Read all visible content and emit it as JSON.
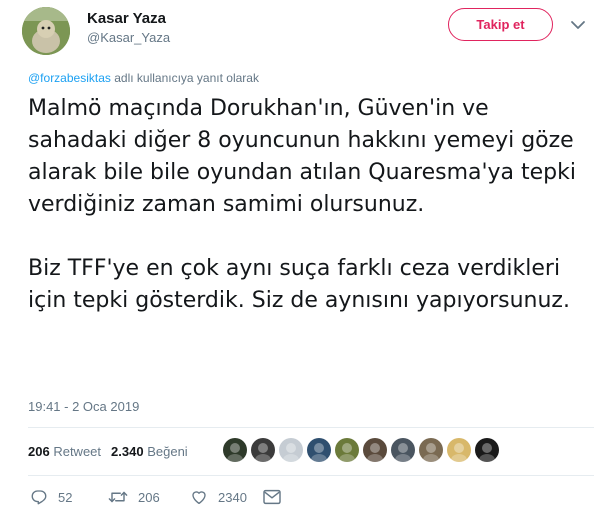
{
  "user": {
    "display_name": "Kasar Yaza",
    "handle": "@Kasar_Yaza"
  },
  "follow_button": {
    "label": "Takip et"
  },
  "reply_context": {
    "mention": "@forzabesiktas",
    "suffix": " adlı kullanıcıya yanıt olarak"
  },
  "tweet": {
    "paragraphs": [
      "Malmö maçında Dorukhan'ın, Güven'in ve sahadaki diğer 8 oyuncunun hakkını yemeyi göze alarak bile bile oyundan atılan Quaresma'ya tepki verdiğiniz zaman samimi olursunuz.",
      "Biz TFF'ye en çok aynı suça farklı ceza verdikleri için tepki gösterdik. Siz de aynısını yapıyorsunuz."
    ],
    "timestamp": "19:41 - 2 Oca 2019"
  },
  "stats": {
    "retweet_count": "206",
    "retweet_label": "Retweet",
    "like_count": "2.340",
    "like_label": "Beğeni"
  },
  "likers": [
    {
      "icon": "liker-avatar-1",
      "bg": "#2e3a2a"
    },
    {
      "icon": "liker-avatar-2",
      "bg": "#3b3b3b"
    },
    {
      "icon": "liker-avatar-3",
      "bg": "#c5ccd3"
    },
    {
      "icon": "liker-avatar-4",
      "bg": "#2f4f6f"
    },
    {
      "icon": "liker-avatar-5",
      "bg": "#6b7a3a"
    },
    {
      "icon": "liker-avatar-6",
      "bg": "#5a4a3c"
    },
    {
      "icon": "liker-avatar-7",
      "bg": "#4a5560"
    },
    {
      "icon": "liker-avatar-8",
      "bg": "#7a6a52"
    },
    {
      "icon": "liker-avatar-9",
      "bg": "#d8b86a"
    },
    {
      "icon": "liker-avatar-10",
      "bg": "#1a1a1a"
    }
  ],
  "actions": {
    "reply_count": "52",
    "retweet_count": "206",
    "like_count": "2340"
  },
  "colors": {
    "accent": "#e0245e",
    "link": "#1da1f2",
    "secondary_text": "#657786",
    "divider": "#e6ecf0"
  }
}
